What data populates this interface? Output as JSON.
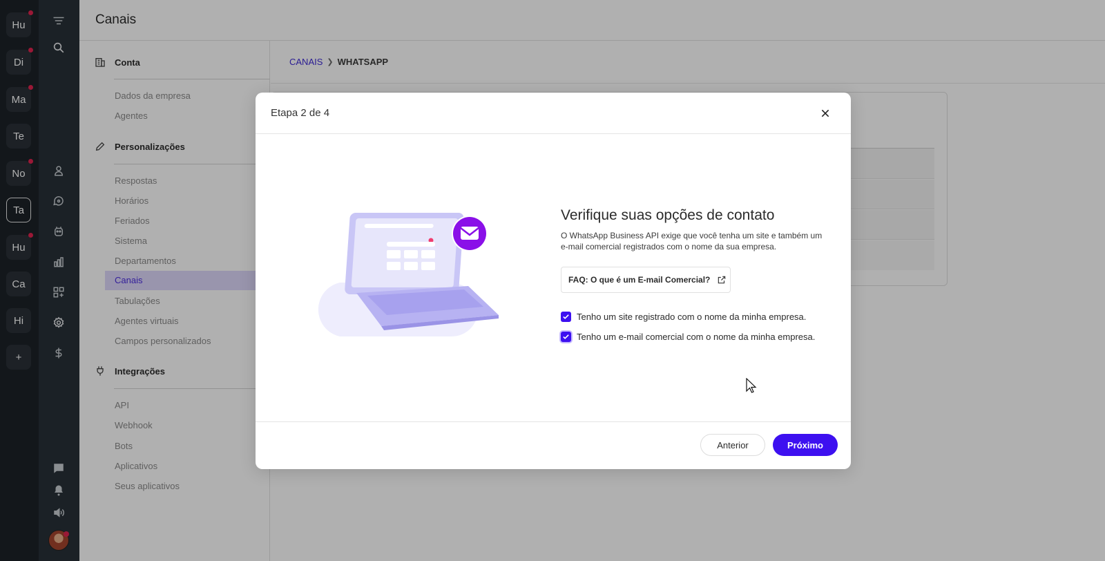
{
  "workspaces": [
    {
      "label": "Hu",
      "dot": true
    },
    {
      "label": "Di",
      "dot": true
    },
    {
      "label": "Ma",
      "dot": true
    },
    {
      "label": "Te",
      "dot": false
    },
    {
      "label": "No",
      "dot": true
    },
    {
      "label": "Ta",
      "dot": false,
      "active": true
    },
    {
      "label": "Hu",
      "dot": true
    },
    {
      "label": "Ca",
      "dot": false
    },
    {
      "label": "Hi",
      "dot": false
    },
    {
      "label": "+",
      "dot": false
    }
  ],
  "iconbar": [
    "menu-icon",
    "search-icon",
    "user-icon",
    "chat-bot-icon",
    "robot-icon",
    "bar-chart-icon",
    "apps-add-icon",
    "gear-icon",
    "dollar-icon",
    "message-icon",
    "bell-icon",
    "speaker-icon"
  ],
  "topbar": {
    "title": "Canais"
  },
  "settings_nav": {
    "sections": [
      {
        "title": "Conta",
        "icon": "building-icon",
        "items": [
          "Dados da empresa",
          "Agentes"
        ]
      },
      {
        "title": "Personalizações",
        "icon": "pencil-icon",
        "items": [
          "Respostas",
          "Horários",
          "Feriados",
          "Sistema",
          "Departamentos",
          "Canais",
          "Tabulações",
          "Agentes virtuais",
          "Campos personalizados"
        ]
      },
      {
        "title": "Integrações",
        "icon": "plug-icon",
        "items": [
          "API",
          "Webhook",
          "Bots",
          "Aplicativos",
          "Seus aplicativos"
        ]
      }
    ],
    "active_item": "Canais"
  },
  "breadcrumb": {
    "parent": "CANAIS",
    "separator": "❯",
    "current": "WHATSAPP"
  },
  "modal": {
    "step": "Etapa 2 de 4",
    "heading": "Verifique suas opções de contato",
    "description": "O WhatsApp Business API exige que você tenha um site e também um e-mail comercial registrados com o nome da sua empresa.",
    "faq_link": "FAQ: O que é um E-mail Comercial?",
    "checkboxes": [
      {
        "label": "Tenho um site registrado com o nome da minha empresa.",
        "checked": true
      },
      {
        "label": "Tenho um e-mail comercial com o nome da minha empresa.",
        "checked": true
      }
    ],
    "prev_button": "Anterior",
    "next_button": "Próximo"
  },
  "colors": {
    "accent": "#3d10f0",
    "rail": "#1c2228",
    "iconbar": "#283037",
    "notification": "#e0244f",
    "active_nav_bg": "#ded8fb"
  }
}
